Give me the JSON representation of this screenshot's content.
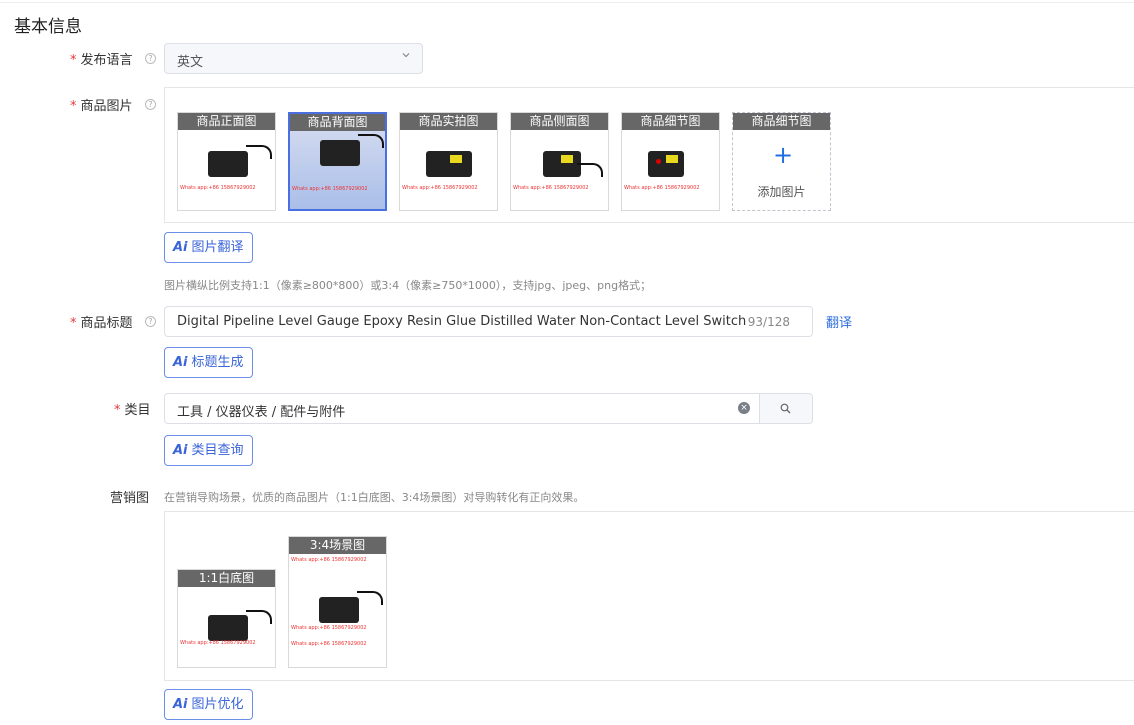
{
  "section": {
    "title": "基本信息"
  },
  "language": {
    "label": "发布语言",
    "value": "英文"
  },
  "images": {
    "label": "商品图片",
    "thumbs": [
      "商品正面图",
      "商品背面图",
      "商品实拍图",
      "商品侧面图",
      "商品细节图"
    ],
    "add_caption": "商品细节图",
    "add_label": "添加图片",
    "translate_button": "图片翻译",
    "hint": "图片横纵比例支持1:1（像素≥800*800）或3:4（像素≥750*1000），支持jpg、jpeg、png格式；",
    "watermark": "Whats app:+86 15867929002"
  },
  "title": {
    "label": "商品标题",
    "value": "Digital Pipeline Level Gauge Epoxy Resin Glue Distilled Water Non-Contact Level Switch Sen",
    "count": "93/128",
    "translate_link": "翻译",
    "generate_button": "标题生成"
  },
  "category": {
    "label": "类目",
    "value": "工具 / 仪器仪表 / 配件与附件",
    "query_button": "类目查询"
  },
  "marketing": {
    "label": "营销图",
    "hint": "在营销导购场景，优质的商品图片（1:1白底图、3:4场景图）对导购转化有正向效果。",
    "white_bg": "1:1白底图",
    "scene": "3:4场景图",
    "optimize_button": "图片优化"
  },
  "ai_icon": "Ai",
  "colors": {
    "accent": "#3a64d8",
    "required": "#e4393c",
    "link": "#2f6fe0"
  }
}
